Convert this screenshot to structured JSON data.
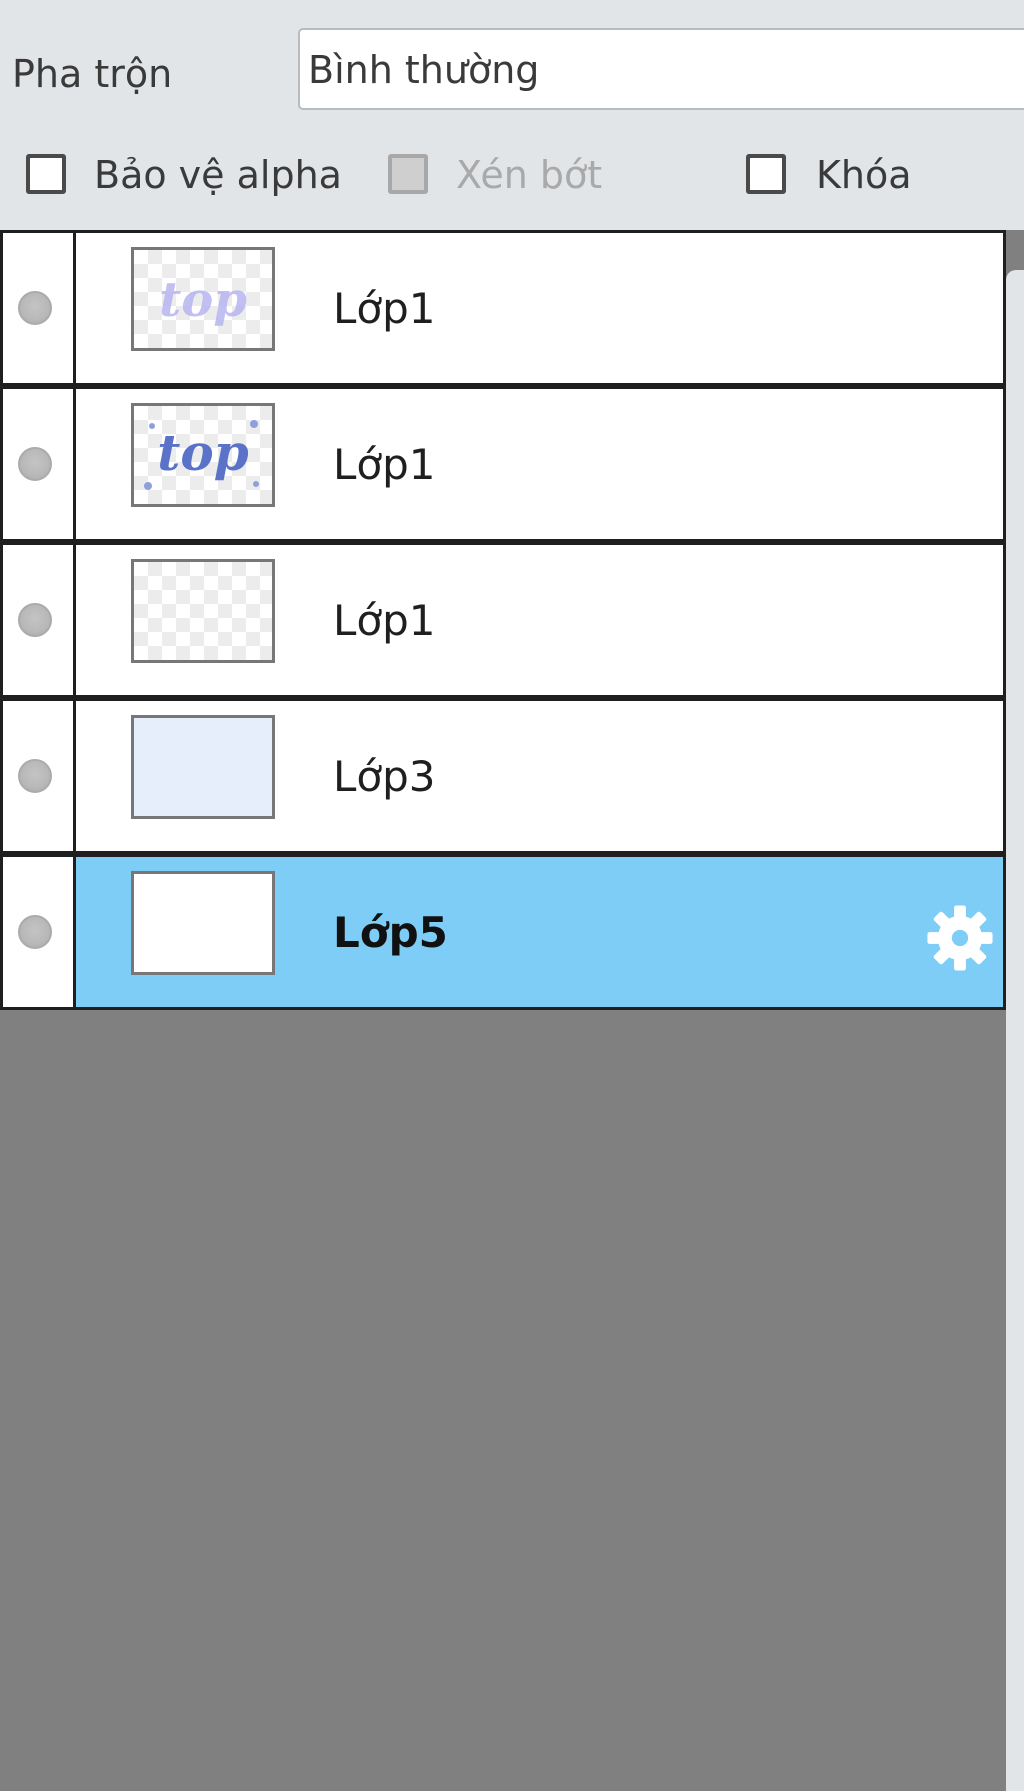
{
  "blend": {
    "label": "Pha trộn",
    "value": "Bình thường"
  },
  "options": [
    {
      "label": "Bảo vệ alpha",
      "checked": false,
      "enabled": true
    },
    {
      "label": "Xén bớt",
      "checked": false,
      "enabled": false
    },
    {
      "label": "Khóa",
      "checked": false,
      "enabled": true
    }
  ],
  "layers": [
    {
      "name": "Lớp1",
      "thumb_text": "top",
      "selected": false
    },
    {
      "name": "Lớp1",
      "thumb_text": "top",
      "selected": false
    },
    {
      "name": "Lớp1",
      "selected": false
    },
    {
      "name": "Lớp3",
      "selected": false
    },
    {
      "name": "Lớp5",
      "selected": true
    }
  ],
  "colors": {
    "panel_bg": "#e2e5e8",
    "list_bg": "#808080",
    "selected_row": "#7dcdf7",
    "thumb_text_light": "#b8b4f0",
    "thumb_text_dark": "#5a72c8"
  },
  "icons": {
    "visibility": "circle-dot-icon",
    "settings": "gear-icon"
  }
}
